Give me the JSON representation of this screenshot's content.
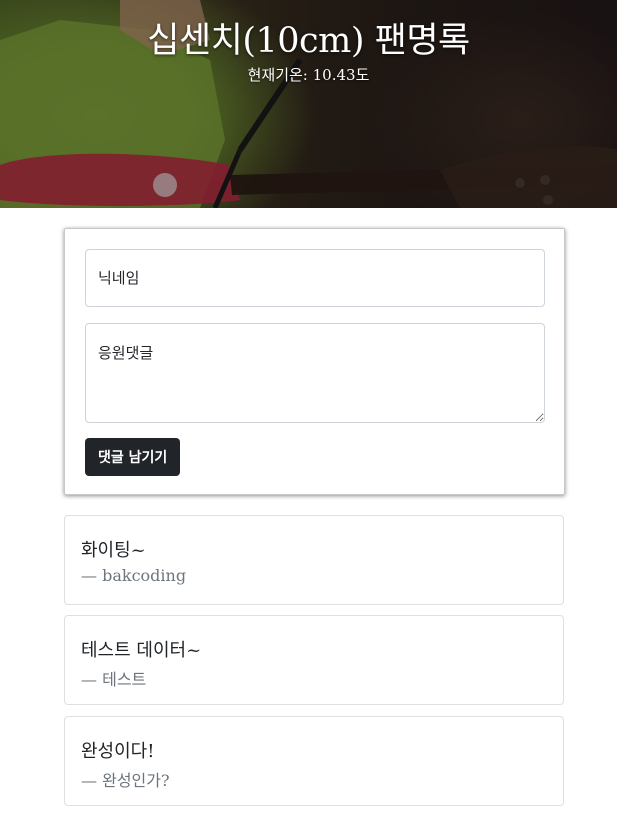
{
  "header": {
    "title": "십센치(10cm) 팬명록",
    "weather_label": "현재기온:",
    "temperature": "10.43도"
  },
  "form": {
    "nickname_placeholder": "닉네임",
    "comment_placeholder": "응원댓글",
    "submit_label": "댓글 남기기"
  },
  "comments": [
    {
      "text": "화이팅~",
      "dash": "—",
      "author": "bakcoding"
    },
    {
      "text": "테스트 데이터~",
      "dash": "—",
      "author": "테스트"
    },
    {
      "text": "완성이다!",
      "dash": "—",
      "author": "완성인가?"
    }
  ]
}
